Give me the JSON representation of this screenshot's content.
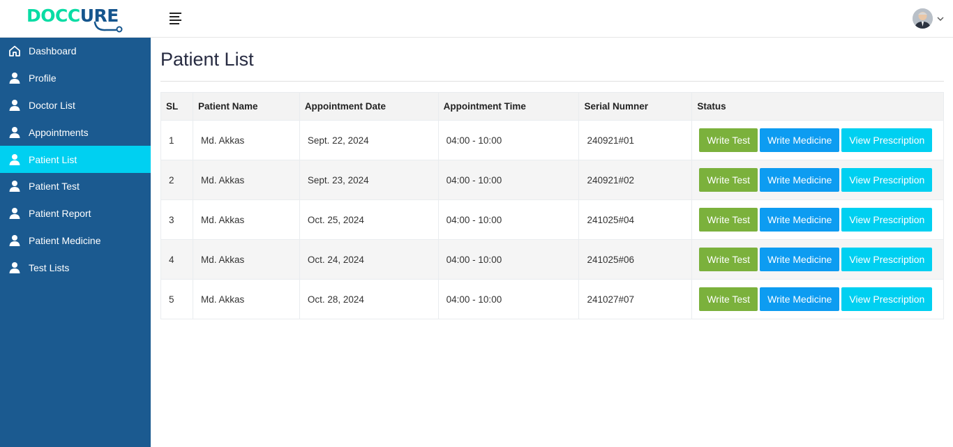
{
  "header": {
    "logo_text_left": "DOCC",
    "logo_text_right": "URE",
    "menu_icon": "hamburger-icon",
    "avatar_icon": "user-avatar",
    "chevron_icon": "chevron-down-icon"
  },
  "sidebar": {
    "items": [
      {
        "label": "Dashboard",
        "icon": "home-icon",
        "active": false
      },
      {
        "label": "Profile",
        "icon": "user-icon",
        "active": false
      },
      {
        "label": "Doctor List",
        "icon": "user-icon",
        "active": false
      },
      {
        "label": "Appointments",
        "icon": "user-icon",
        "active": false
      },
      {
        "label": "Patient List",
        "icon": "user-icon",
        "active": true
      },
      {
        "label": "Patient Test",
        "icon": "user-icon",
        "active": false
      },
      {
        "label": "Patient Report",
        "icon": "user-icon",
        "active": false
      },
      {
        "label": "Patient Medicine",
        "icon": "user-icon",
        "active": false
      },
      {
        "label": "Test Lists",
        "icon": "user-icon",
        "active": false
      }
    ],
    "bg_color": "#1b5a90",
    "active_color": "#00d0f1"
  },
  "main": {
    "title": "Patient List",
    "table": {
      "headers": [
        "SL",
        "Patient Name",
        "Appointment Date",
        "Appointment Time",
        "Serial Numner",
        "Status"
      ],
      "rows": [
        {
          "sl": "1",
          "name": "Md. Akkas",
          "date": "Sept. 22, 2024",
          "time": "04:00 - 10:00",
          "serial": "240921#01"
        },
        {
          "sl": "2",
          "name": "Md. Akkas",
          "date": "Sept. 23, 2024",
          "time": "04:00 - 10:00",
          "serial": "240921#02"
        },
        {
          "sl": "3",
          "name": "Md. Akkas",
          "date": "Oct. 25, 2024",
          "time": "04:00 - 10:00",
          "serial": "241025#04"
        },
        {
          "sl": "4",
          "name": "Md. Akkas",
          "date": "Oct. 24, 2024",
          "time": "04:00 - 10:00",
          "serial": "241025#06"
        },
        {
          "sl": "5",
          "name": "Md. Akkas",
          "date": "Oct. 28, 2024",
          "time": "04:00 - 10:00",
          "serial": "241027#07"
        }
      ],
      "buttons": {
        "write_test": "Write Test",
        "write_medicine": "Write Medicine",
        "view_prescription": "View Prescription"
      },
      "button_colors": {
        "write_test": "#7bb13c",
        "write_medicine": "#0d9cf1",
        "view_prescription": "#00d0f1"
      }
    }
  }
}
